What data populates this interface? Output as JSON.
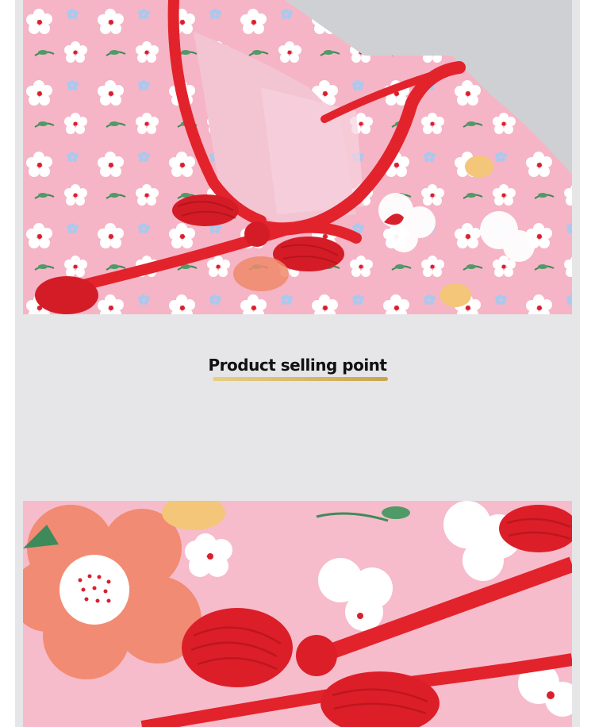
{
  "section_heading": {
    "title": "Product selling point",
    "underline_color": "#d4b45c"
  },
  "photos": [
    {
      "name": "collar-closeup",
      "content": "pink floral fabric with red piped mandarin collar and red knot frog button"
    },
    {
      "name": "frog-button-closeup",
      "content": "red knotted frog button on pink floral fabric"
    }
  ],
  "colors": {
    "panel_background": "#e6e6e8",
    "fabric_pink": "#f6b8c8",
    "piping_red": "#e2232c"
  }
}
